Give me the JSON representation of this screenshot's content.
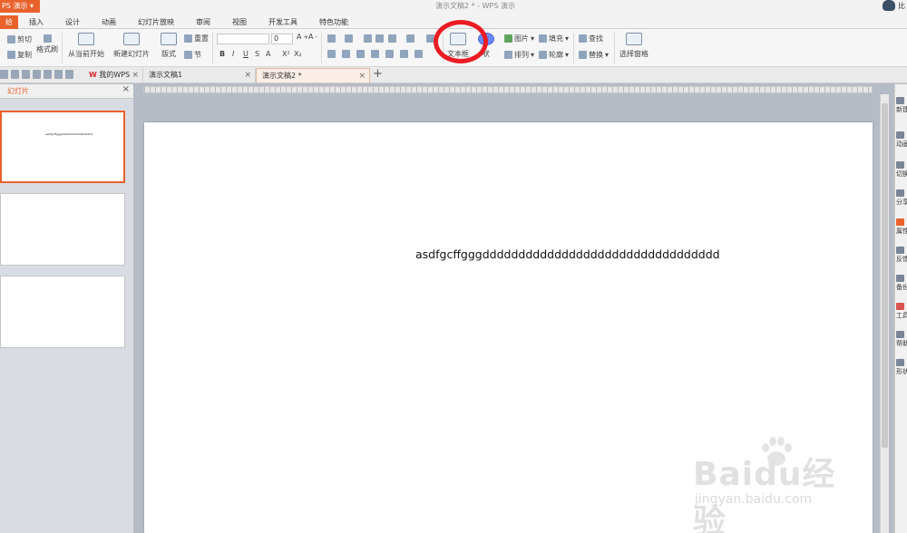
{
  "app": {
    "name": "PS 演示",
    "window_title": "演示文稿2 * - WPS 演示",
    "user_label": "比"
  },
  "menu": {
    "items": [
      "给",
      "插入",
      "设计",
      "动画",
      "幻灯片放映",
      "审阅",
      "视图",
      "开发工具",
      "特色功能"
    ]
  },
  "ribbon": {
    "cut": "剪切",
    "copy": "复制",
    "format_painter": "格式刷",
    "play_from_current": "从当前开始",
    "new_slide": "新建幻灯片",
    "layout": "版式",
    "reset": "重置",
    "section": "节",
    "font_size_value": "0",
    "text_box": "文本框",
    "shape": "状",
    "picture": "图片",
    "fill": "填充",
    "arrange": "排列",
    "outline": "轮廓",
    "find": "查找",
    "replace": "替换",
    "select_pane": "选择窗格"
  },
  "tabs": {
    "my_wps": "我的WPS",
    "doc1": "演示文稿1",
    "doc2": "演示文稿2 *"
  },
  "left_panel": {
    "title": "幻灯片",
    "thumb_text": "asdfgcffgggdddddddddddddddddd"
  },
  "slide": {
    "text": "asdfgcffgggddddddddddddddddddddddddddddddddd"
  },
  "side_panel": {
    "items": [
      "新建",
      "动画",
      "切换",
      "分享",
      "属性",
      "反馈",
      "备份",
      "工具",
      "帮助",
      "形状"
    ]
  },
  "watermark": {
    "main": "Baidu经验",
    "sub": "jingyan.baidu.com"
  },
  "colors": {
    "accent": "#e9622c",
    "highlight_ring": "#ea1c23"
  }
}
